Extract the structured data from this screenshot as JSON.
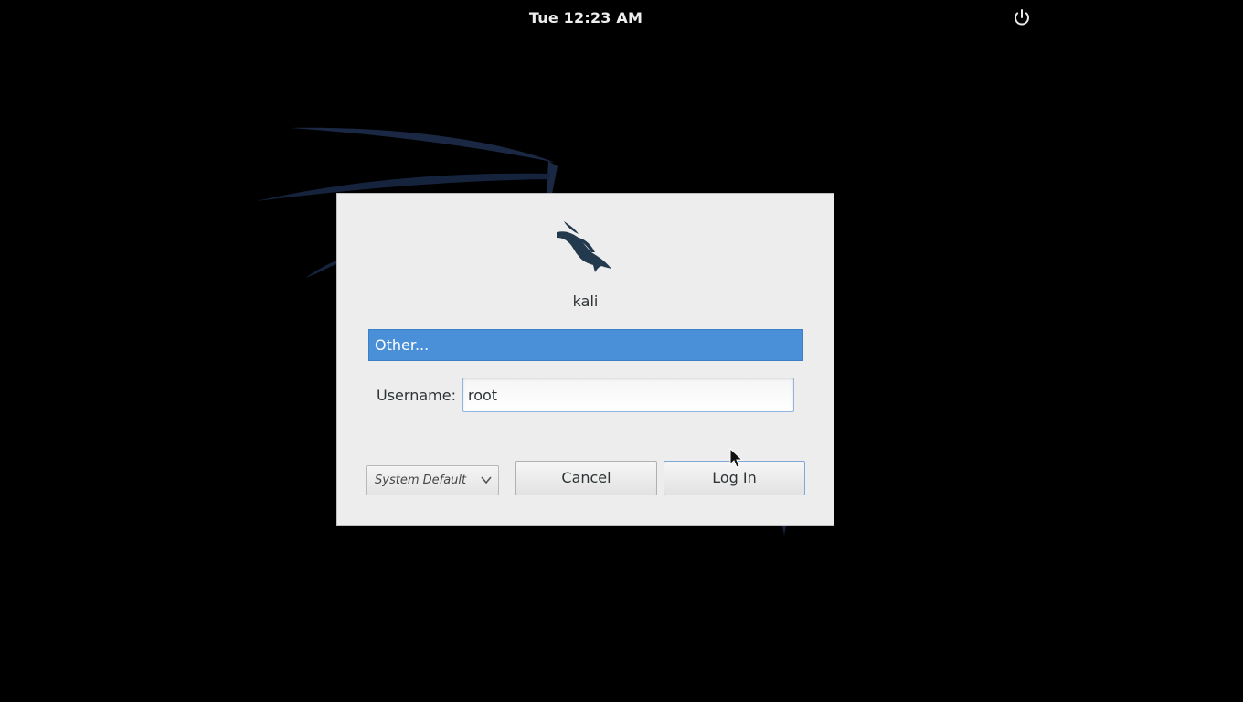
{
  "top_bar": {
    "clock": "Tue 12:23 AM",
    "power_icon": "power-icon"
  },
  "login": {
    "host_name": "kali",
    "logo_icon": "kali-dragon-icon",
    "user_list": {
      "selected_item": "Other..."
    },
    "username": {
      "label": "Username:",
      "value": "root"
    },
    "session": {
      "selected": "System Default",
      "chevron_icon": "chevron-down-icon"
    },
    "buttons": {
      "cancel": "Cancel",
      "login": "Log In"
    }
  },
  "colors": {
    "background": "#000000",
    "dialog_background": "#ededed",
    "selection_blue": "#4a90d9",
    "wallpaper_lines": "#1b2a45"
  }
}
